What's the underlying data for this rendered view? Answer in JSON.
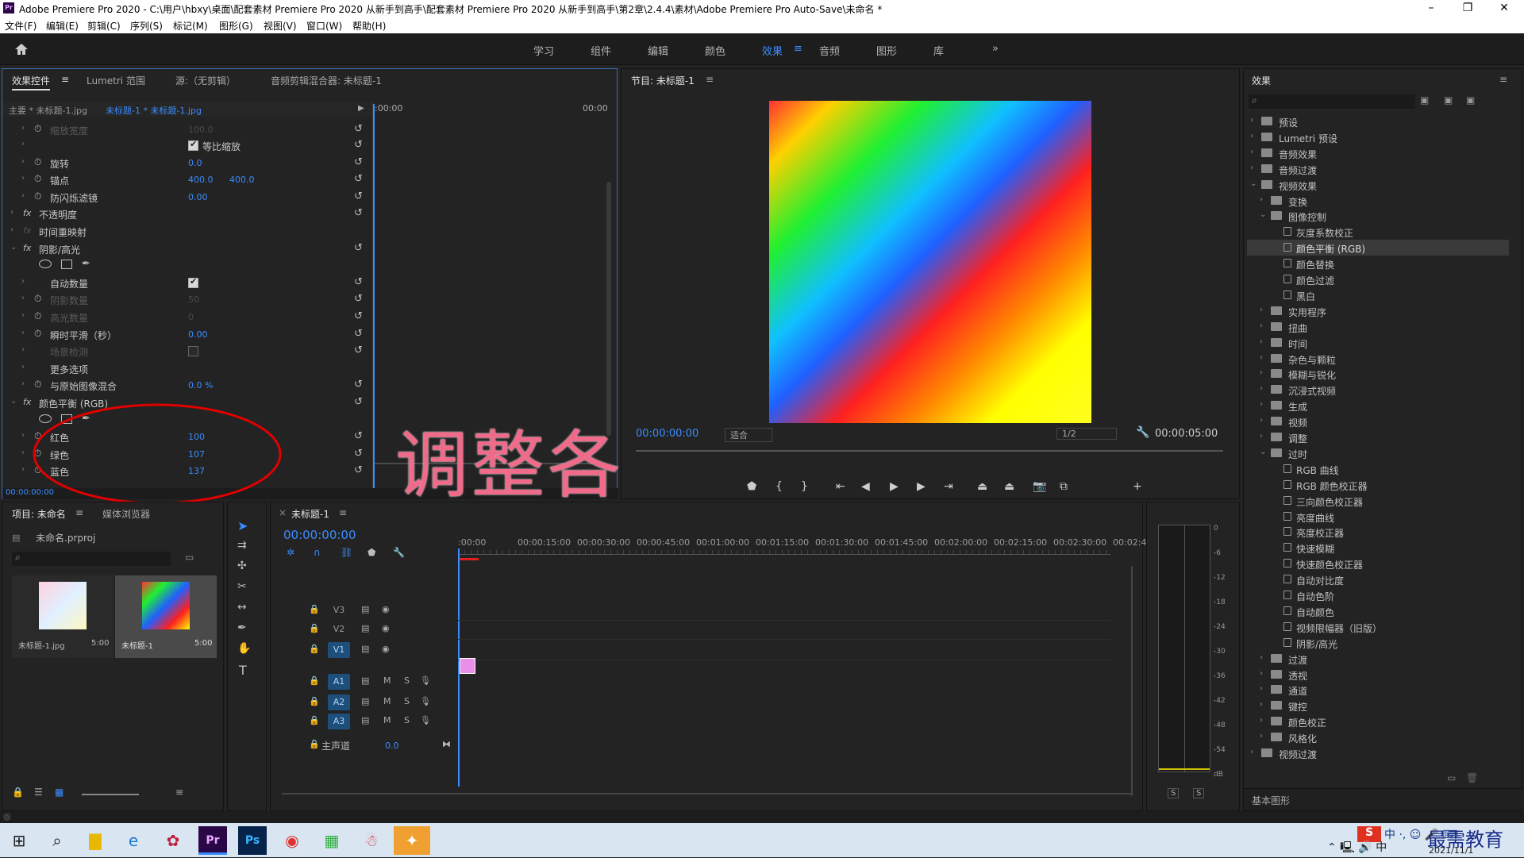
{
  "window": {
    "title": "Adobe Premiere Pro 2020 - C:\\用户\\hbxy\\桌面\\配套素材 Premiere Pro 2020 从新手到高手\\配套素材 Premiere Pro 2020 从新手到高手\\第2章\\2.4.4\\素材\\Adobe Premiere Pro Auto-Save\\未命名 *",
    "minimize": "–",
    "maximize": "❐",
    "close": "✕"
  },
  "menu": [
    "文件(F)",
    "编辑(E)",
    "剪辑(C)",
    "序列(S)",
    "标记(M)",
    "图形(G)",
    "视图(V)",
    "窗口(W)",
    "帮助(H)"
  ],
  "workspaces": [
    "学习",
    "组件",
    "编辑",
    "颜色",
    "效果",
    "音频",
    "图形",
    "库"
  ],
  "workspace_more": "»",
  "effect_controls": {
    "tabs": [
      "效果控件",
      "Lumetri 范围",
      "源:（无剪辑）",
      "音频剪辑混合器: 未标题-1"
    ],
    "master": "主要 * 未标题-1.jpg",
    "clip": "未标题-1 * 未标题-1.jpg",
    "time_start": ":00:00",
    "time_end": "00:00",
    "current_time": "00:00:00:00",
    "rows": [
      {
        "label": "缩放宽度",
        "value": "100.0",
        "dim": true
      },
      {
        "label": "等比缩放",
        "check": true
      },
      {
        "label": "旋转",
        "value": "0.0"
      },
      {
        "label": "锚点",
        "value": "400.0",
        "value2": "400.0"
      },
      {
        "label": "防闪烁滤镜",
        "value": "0.00"
      },
      {
        "label": "不透明度",
        "fx": true
      },
      {
        "label": "时间重映射",
        "fx": true,
        "dimfx": true
      },
      {
        "label": "阴影/高光",
        "fx": true
      },
      {
        "label": "shapes",
        "shapes": true
      },
      {
        "label": "自动数量",
        "check": true
      },
      {
        "label": "阴影数量",
        "value": "50",
        "dim": true
      },
      {
        "label": "高光数量",
        "value": "0",
        "dim": true
      },
      {
        "label": "瞬时平滑（秒）",
        "value": "0.00"
      },
      {
        "label": "场景检测",
        "check": false,
        "dim": true
      },
      {
        "label": "更多选项"
      },
      {
        "label": "与原始图像混合",
        "value": "0.0 %"
      },
      {
        "label": "颜色平衡 (RGB)",
        "fx": true
      },
      {
        "label": "shapes2",
        "shapes": true
      },
      {
        "label": "红色",
        "value": "100"
      },
      {
        "label": "绿色",
        "value": "107"
      },
      {
        "label": "蓝色",
        "value": "137"
      }
    ]
  },
  "annotation": {
    "text": "调整各参数",
    "color": "#f06a8a"
  },
  "program": {
    "title": "节目: 未标题-1",
    "timecode": "00:00:00:00",
    "fit": "适合",
    "quality": "1/2",
    "duration": "00:00:05:00"
  },
  "effects_panel": {
    "title": "效果",
    "items": [
      {
        "label": "预设",
        "level": 0,
        "open": false
      },
      {
        "label": "Lumetri 预设",
        "level": 0,
        "open": false
      },
      {
        "label": "音频效果",
        "level": 0,
        "open": false
      },
      {
        "label": "音频过渡",
        "level": 0,
        "open": false
      },
      {
        "label": "视频效果",
        "level": 0,
        "open": true
      },
      {
        "label": "变换",
        "level": 1,
        "open": false
      },
      {
        "label": "图像控制",
        "level": 1,
        "open": true
      },
      {
        "label": "灰度系数校正",
        "level": 2
      },
      {
        "label": "颜色平衡 (RGB)",
        "level": 2,
        "sel": true
      },
      {
        "label": "颜色替换",
        "level": 2
      },
      {
        "label": "颜色过滤",
        "level": 2
      },
      {
        "label": "黑白",
        "level": 2
      },
      {
        "label": "实用程序",
        "level": 1,
        "open": false
      },
      {
        "label": "扭曲",
        "level": 1,
        "open": false
      },
      {
        "label": "时间",
        "level": 1,
        "open": false
      },
      {
        "label": "杂色与颗粒",
        "level": 1,
        "open": false
      },
      {
        "label": "模糊与锐化",
        "level": 1,
        "open": false
      },
      {
        "label": "沉浸式视频",
        "level": 1,
        "open": false
      },
      {
        "label": "生成",
        "level": 1,
        "open": false
      },
      {
        "label": "视频",
        "level": 1,
        "open": false
      },
      {
        "label": "调整",
        "level": 1,
        "open": false
      },
      {
        "label": "过时",
        "level": 1,
        "open": true
      },
      {
        "label": "RGB 曲线",
        "level": 2
      },
      {
        "label": "RGB 颜色校正器",
        "level": 2
      },
      {
        "label": "三向颜色校正器",
        "level": 2
      },
      {
        "label": "亮度曲线",
        "level": 2
      },
      {
        "label": "亮度校正器",
        "level": 2
      },
      {
        "label": "快速模糊",
        "level": 2
      },
      {
        "label": "快速颜色校正器",
        "level": 2
      },
      {
        "label": "自动对比度",
        "level": 2
      },
      {
        "label": "自动色阶",
        "level": 2
      },
      {
        "label": "自动颜色",
        "level": 2
      },
      {
        "label": "视频限幅器（旧版）",
        "level": 2
      },
      {
        "label": "阴影/高光",
        "level": 2
      },
      {
        "label": "过渡",
        "level": 1,
        "open": false
      },
      {
        "label": "透视",
        "level": 1,
        "open": false
      },
      {
        "label": "通道",
        "level": 1,
        "open": false
      },
      {
        "label": "键控",
        "level": 1,
        "open": false
      },
      {
        "label": "颜色校正",
        "level": 1,
        "open": false
      },
      {
        "label": "风格化",
        "level": 1,
        "open": false
      },
      {
        "label": "视频过渡",
        "level": 0,
        "open": false
      }
    ],
    "footer": "基本图形"
  },
  "project": {
    "tabs": [
      "项目: 未命名",
      "媒体浏览器"
    ],
    "file": "未命名.prproj",
    "items": [
      {
        "name": "未标题-1.jpg",
        "dur": "5:00"
      },
      {
        "name": "未标题-1",
        "dur": "5:00"
      }
    ]
  },
  "timeline": {
    "tab": "未标题-1",
    "timecode": "00:00:00:00",
    "ruler": [
      ":00:00",
      "00:00:15:00",
      "00:00:30:00",
      "00:00:45:00",
      "00:01:00:00",
      "00:01:15:00",
      "00:01:30:00",
      "00:01:45:00",
      "00:02:00:00",
      "00:02:15:00",
      "00:02:30:00",
      "00:02:45:"
    ],
    "video_tracks": [
      "V3",
      "V2",
      "V1"
    ],
    "audio_tracks": [
      "A1",
      "A2",
      "A3"
    ],
    "master": "主声道",
    "master_val": "0.0"
  },
  "meter": {
    "scale": [
      "0",
      "-6",
      "-12",
      "-18",
      "-24",
      "-30",
      "-36",
      "-42",
      "-48",
      "-54",
      "dB"
    ],
    "solo": [
      "S",
      "S"
    ]
  },
  "taskbar": {
    "ime": "中 ·, ☺ 🎤 ⌨",
    "brand": "最需教育",
    "date": "2021/11/1"
  }
}
